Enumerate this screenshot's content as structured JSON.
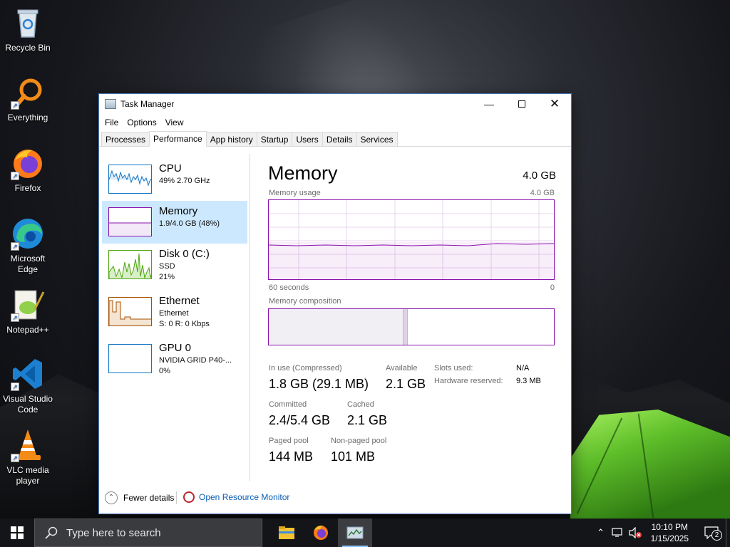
{
  "desktop": {
    "icons": [
      {
        "label": "Recycle Bin"
      },
      {
        "label": "Everything"
      },
      {
        "label": "Firefox"
      },
      {
        "label": "Microsoft Edge"
      },
      {
        "label": "Notepad++"
      },
      {
        "label": "Visual Studio Code"
      },
      {
        "label": "VLC media player"
      }
    ]
  },
  "window": {
    "title": "Task Manager",
    "menu": [
      "File",
      "Options",
      "View"
    ],
    "tabs": [
      "Processes",
      "Performance",
      "App history",
      "Startup",
      "Users",
      "Details",
      "Services"
    ],
    "active_tab": "Performance"
  },
  "sidebar": {
    "items": [
      {
        "name": "CPU",
        "line1": "49% 2.70 GHz",
        "line2": "",
        "color": "#1175c4"
      },
      {
        "name": "Memory",
        "line1": "1.9/4.0 GB (48%)",
        "line2": "",
        "color": "#8b12ae"
      },
      {
        "name": "Disk 0 (C:)",
        "line1": "SSD",
        "line2": "21%",
        "color": "#4da60c"
      },
      {
        "name": "Ethernet",
        "line1": "Ethernet",
        "line2": "S: 0 R: 0 Kbps",
        "color": "#a74f01"
      },
      {
        "name": "GPU 0",
        "line1": "NVIDIA GRID P40-...",
        "line2": "0%",
        "color": "#1175c4"
      }
    ],
    "selected": "Memory"
  },
  "memory": {
    "heading": "Memory",
    "total": "4.0 GB",
    "usage_label": "Memory usage",
    "usage_max": "4.0 GB",
    "time_left": "60 seconds",
    "time_right": "0",
    "composition_label": "Memory composition",
    "usage_fraction": 0.48,
    "in_use_fraction": 0.47,
    "modified_fraction": 0.015,
    "stats": {
      "in_use_label": "In use (Compressed)",
      "in_use_value": "1.8 GB (29.1 MB)",
      "available_label": "Available",
      "available_value": "2.1 GB",
      "slots_label": "Slots used:",
      "slots_value": "N/A",
      "hw_reserved_label": "Hardware reserved:",
      "hw_reserved_value": "9.3 MB",
      "committed_label": "Committed",
      "committed_value": "2.4/5.4 GB",
      "cached_label": "Cached",
      "cached_value": "2.1 GB",
      "paged_label": "Paged pool",
      "paged_value": "144 MB",
      "nonpaged_label": "Non-paged pool",
      "nonpaged_value": "101 MB"
    }
  },
  "footer": {
    "fewer_details": "Fewer details",
    "open_resource_monitor": "Open Resource Monitor"
  },
  "taskbar": {
    "search_placeholder": "Type here to search",
    "time": "10:10 PM",
    "date": "1/15/2025",
    "notification_count": "2"
  }
}
